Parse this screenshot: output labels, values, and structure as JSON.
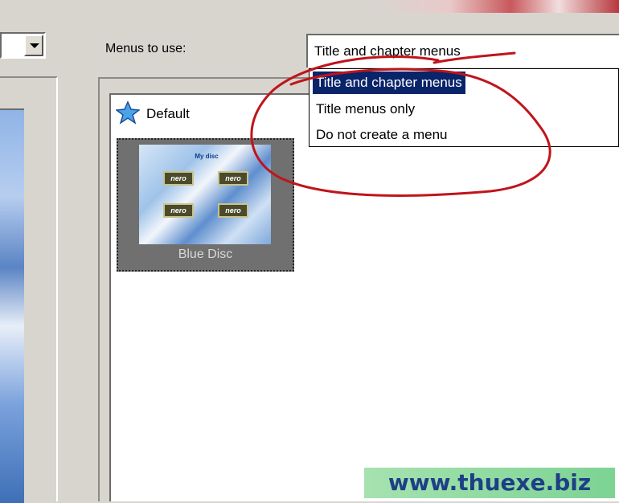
{
  "menus": {
    "label": "Menus to use:",
    "selected": "Title and chapter menus",
    "options": [
      "Title and chapter menus",
      "Title menus only",
      "Do not create a menu"
    ]
  },
  "template_list": {
    "header_label": "Default",
    "header_icon": "star-icon",
    "items": [
      {
        "caption": "Blue Disc",
        "thumbnail_title": "My disc",
        "thumbnail_buttons": [
          "nero",
          "nero",
          "nero",
          "nero"
        ]
      }
    ]
  },
  "watermark": "www.thuexe.biz",
  "colors": {
    "selection": "#0a246a",
    "annotation": "#c0141b",
    "dialog_bg": "#d8d5cf",
    "watermark_bg": "#8fd9a0",
    "watermark_text": "#1e3f86"
  }
}
